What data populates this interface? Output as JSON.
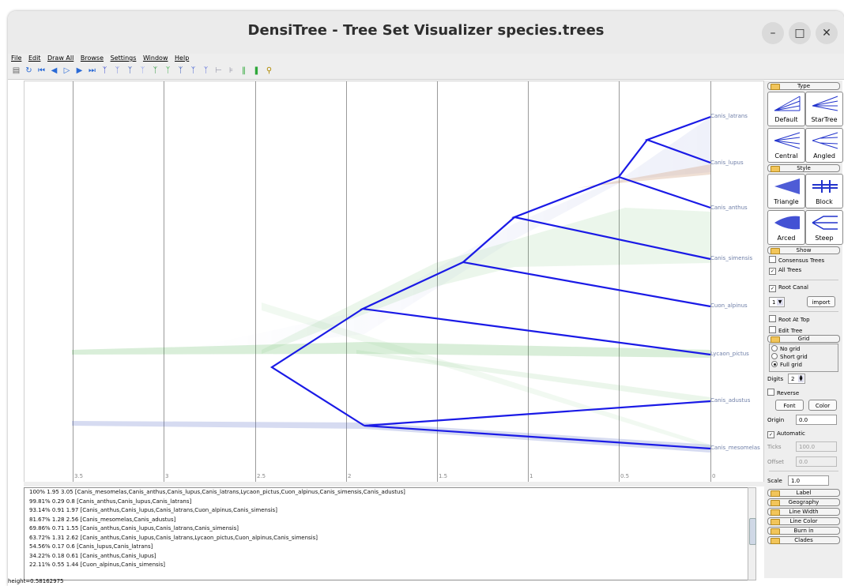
{
  "window": {
    "title": "DensiTree - Tree Set Visualizer species.trees",
    "minimize_icon": "minimize-icon",
    "maximize_icon": "maximize-icon",
    "close_icon": "close-icon"
  },
  "menu": [
    "File",
    "Edit",
    "Draw All",
    "Browse",
    "Settings",
    "Window",
    "Help"
  ],
  "toolbar": {
    "icons": [
      "open-icon",
      "reload-icon",
      "first-tree-icon",
      "previous-tree-icon",
      "play-icon",
      "next-tree-icon",
      "last-tree-icon",
      "tree-view-1-icon",
      "tree-view-2-icon",
      "tree-view-3-icon",
      "tree-view-4-icon",
      "tree-view-5-icon",
      "tree-view-6-icon",
      "tree-view-7-icon",
      "tree-view-8-icon",
      "tree-view-9-icon",
      "tree-view-10-icon",
      "tree-view-11-icon",
      "column-view-icon",
      "bar-view-icon",
      "help-icon"
    ]
  },
  "tree": {
    "tick_labels": [
      "3.5",
      "3",
      "2.5",
      "2",
      "1.5",
      "1",
      "0.5",
      "0"
    ],
    "taxa": [
      "Canis_latrans",
      "Canis_lupus",
      "Canis_anthus",
      "Canis_simensis",
      "Cuon_alpinus",
      "Lycaon_pictus",
      "Canis_adustus",
      "Canis_mesomelas"
    ],
    "colors": {
      "consensus": "#1a1ae6",
      "haze_blue": "#5a6ec8",
      "haze_green": "#3aa83a",
      "haze_brown": "#b05a20",
      "grid": "#9a9a9a"
    }
  },
  "clades": [
    "100% 1.95 3.05 [Canis_mesomelas,Canis_anthus,Canis_lupus,Canis_latrans,Lycaon_pictus,Cuon_alpinus,Canis_simensis,Canis_adustus]",
    "99.81% 0.29 0.8 [Canis_anthus,Canis_lupus,Canis_latrans]",
    "93.14% 0.91 1.97 [Canis_anthus,Canis_lupus,Canis_latrans,Cuon_alpinus,Canis_simensis]",
    "81.67% 1.28 2.56 [Canis_mesomelas,Canis_adustus]",
    "69.86% 0.71 1.55 [Canis_anthus,Canis_lupus,Canis_latrans,Canis_simensis]",
    "63.72% 1.31 2.62 [Canis_anthus,Canis_lupus,Canis_latrans,Lycaon_pictus,Cuon_alpinus,Canis_simensis]",
    "54.56% 0.17 0.6 [Canis_lupus,Canis_latrans]",
    "34.22% 0.18 0.61 [Canis_anthus,Canis_lupus]",
    "22.11% 0.55 1.44 [Cuon_alpinus,Canis_simensis]"
  ],
  "status": "height=0.58162975",
  "panel": {
    "sections": {
      "type": "Type",
      "style": "Style",
      "show": "Show",
      "grid": "Grid",
      "label": "Label",
      "geography": "Geography",
      "line_width": "Line Width",
      "line_color": "Line Color",
      "burn_in": "Burn in",
      "clades": "Clades"
    },
    "type_buttons": [
      "Default",
      "StarTree",
      "Central",
      "Angled"
    ],
    "style_buttons": [
      "Triangle",
      "Block",
      "Arced",
      "Steep"
    ],
    "show": {
      "consensus_trees": "Consensus Trees",
      "consensus_checked": false,
      "all_trees": "All Trees",
      "all_checked": true,
      "root_canal": "Root Canal",
      "root_canal_checked": true,
      "root_canal_value": "1",
      "import_label": "import",
      "root_at_top": "Root At Top",
      "root_at_top_checked": false,
      "edit_tree": "Edit Tree",
      "edit_tree_checked": false
    },
    "grid": {
      "options": [
        "No grid",
        "Short grid",
        "Full grid"
      ],
      "selected": "Full grid",
      "digits_label": "Digits",
      "digits_value": "2",
      "reverse_label": "Reverse",
      "reverse_checked": false,
      "font_label": "Font",
      "color_label": "Color",
      "origin_label": "Origin",
      "origin_value": "0.0",
      "automatic_label": "Automatic",
      "automatic_checked": true,
      "ticks_label": "Ticks",
      "ticks_value": "100.0",
      "offset_label": "Offset",
      "offset_value": "0.0",
      "scale_label": "Scale",
      "scale_value": "1.0"
    }
  }
}
